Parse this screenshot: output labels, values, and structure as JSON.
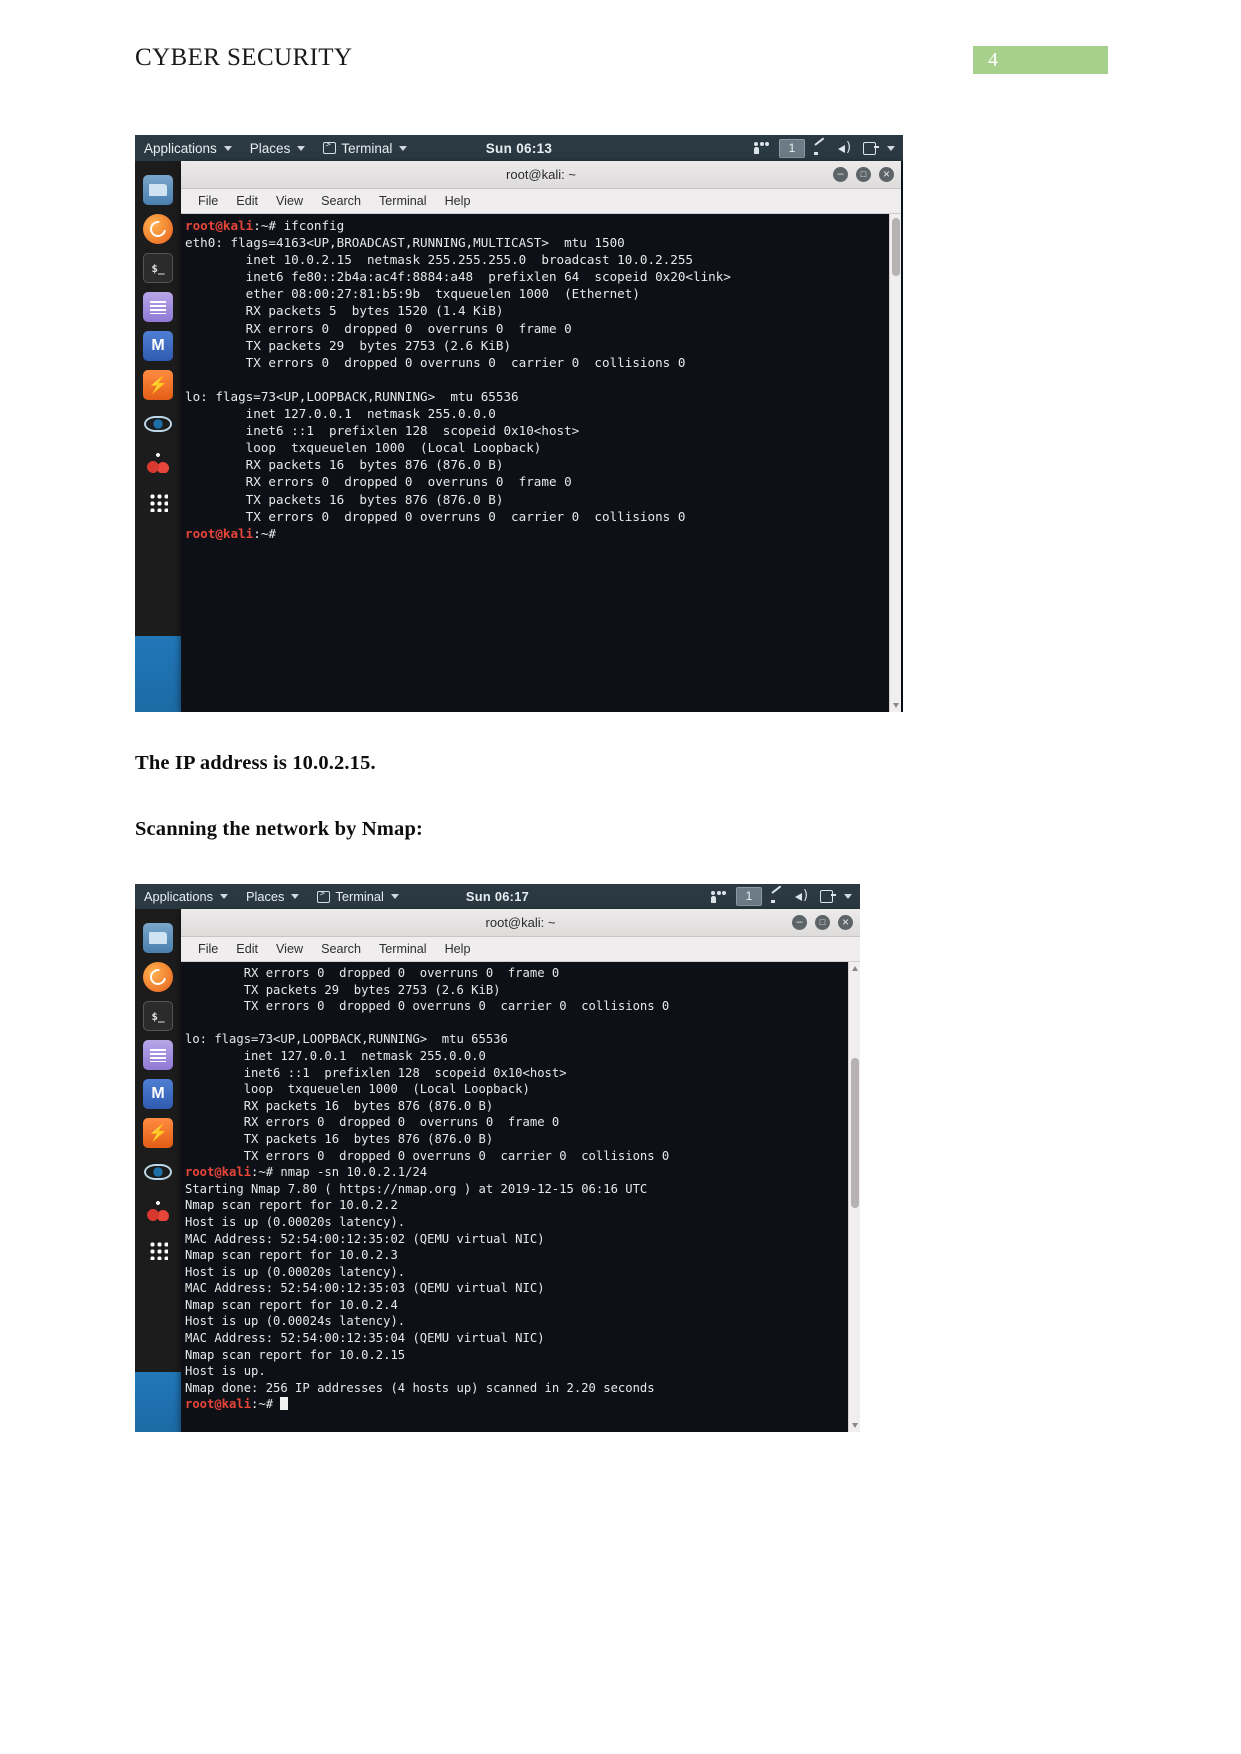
{
  "document": {
    "header_title": "CYBER SECURITY",
    "page_number": "4",
    "accent_color": "#a8d08d",
    "paragraphs": {
      "ip_statement": "The IP address is 10.0.2.15.",
      "scan_heading": "Scanning the network by Nmap:"
    }
  },
  "screenshot_1": {
    "panel": {
      "applications": "Applications",
      "places": "Places",
      "terminal": "Terminal",
      "clock": "Sun 06:13",
      "workspace": "1",
      "icons": [
        "users-icon",
        "network-icon",
        "volume-icon",
        "power-icon"
      ]
    },
    "window": {
      "title": "root@kali: ~",
      "menu": [
        "File",
        "Edit",
        "View",
        "Search",
        "Terminal",
        "Help"
      ],
      "controls": [
        "minimize",
        "maximize",
        "close"
      ]
    },
    "terminal_prompt": "root@kali",
    "terminal_prompt_rest": ":~# ifconfig",
    "terminal_body": "eth0: flags=4163<UP,BROADCAST,RUNNING,MULTICAST>  mtu 1500\n        inet 10.0.2.15  netmask 255.255.255.0  broadcast 10.0.2.255\n        inet6 fe80::2b4a:ac4f:8884:a48  prefixlen 64  scopeid 0x20<link>\n        ether 08:00:27:81:b5:9b  txqueuelen 1000  (Ethernet)\n        RX packets 5  bytes 1520 (1.4 KiB)\n        RX errors 0  dropped 0  overruns 0  frame 0\n        TX packets 29  bytes 2753 (2.6 KiB)\n        TX errors 0  dropped 0 overruns 0  carrier 0  collisions 0\n\nlo: flags=73<UP,LOOPBACK,RUNNING>  mtu 65536\n        inet 127.0.0.1  netmask 255.0.0.0\n        inet6 ::1  prefixlen 128  scopeid 0x10<host>\n        loop  txqueuelen 1000  (Local Loopback)\n        RX packets 16  bytes 876 (876.0 B)\n        RX errors 0  dropped 0  overruns 0  frame 0\n        TX packets 16  bytes 876 (876.0 B)\n        TX errors 0  dropped 0 overruns 0  carrier 0  collisions 0\n",
    "terminal_prompt2": "root@kali",
    "terminal_prompt2_rest": ":~#",
    "dock_items": [
      "files-icon",
      "firefox-icon",
      "terminal-icon",
      "text-editor-icon",
      "metasploit-icon",
      "burpsuite-icon",
      "eye-icon",
      "cherrytree-icon",
      "show-applications-icon"
    ]
  },
  "screenshot_2": {
    "panel": {
      "applications": "Applications",
      "places": "Places",
      "terminal": "Terminal",
      "clock": "Sun 06:17",
      "workspace": "1",
      "icons": [
        "users-icon",
        "network-icon",
        "volume-icon",
        "power-icon"
      ]
    },
    "window": {
      "title": "root@kali: ~",
      "menu": [
        "File",
        "Edit",
        "View",
        "Search",
        "Terminal",
        "Help"
      ],
      "controls": [
        "minimize",
        "maximize",
        "close"
      ]
    },
    "terminal_body_top": "        RX errors 0  dropped 0  overruns 0  frame 0\n        TX packets 29  bytes 2753 (2.6 KiB)\n        TX errors 0  dropped 0 overruns 0  carrier 0  collisions 0\n\nlo: flags=73<UP,LOOPBACK,RUNNING>  mtu 65536\n        inet 127.0.0.1  netmask 255.0.0.0\n        inet6 ::1  prefixlen 128  scopeid 0x10<host>\n        loop  txqueuelen 1000  (Local Loopback)\n        RX packets 16  bytes 876 (876.0 B)\n        RX errors 0  dropped 0  overruns 0  frame 0\n        TX packets 16  bytes 876 (876.0 B)\n        TX errors 0  dropped 0 overruns 0  carrier 0  collisions 0\n",
    "nmap_prompt": "root@kali",
    "nmap_command": ":~# nmap -sn 10.0.2.1/24",
    "nmap_output": "Starting Nmap 7.80 ( https://nmap.org ) at 2019-12-15 06:16 UTC\nNmap scan report for 10.0.2.2\nHost is up (0.00020s latency).\nMAC Address: 52:54:00:12:35:02 (QEMU virtual NIC)\nNmap scan report for 10.0.2.3\nHost is up (0.00020s latency).\nMAC Address: 52:54:00:12:35:03 (QEMU virtual NIC)\nNmap scan report for 10.0.2.4\nHost is up (0.00024s latency).\nMAC Address: 52:54:00:12:35:04 (QEMU virtual NIC)\nNmap scan report for 10.0.2.15\nHost is up.\nNmap done: 256 IP addresses (4 hosts up) scanned in 2.20 seconds",
    "final_prompt": "root@kali",
    "final_prompt_rest": ":~# ",
    "dock_items": [
      "files-icon",
      "firefox-icon",
      "terminal-icon",
      "text-editor-icon",
      "metasploit-icon",
      "burpsuite-icon",
      "eye-icon",
      "cherrytree-icon",
      "show-applications-icon"
    ]
  }
}
